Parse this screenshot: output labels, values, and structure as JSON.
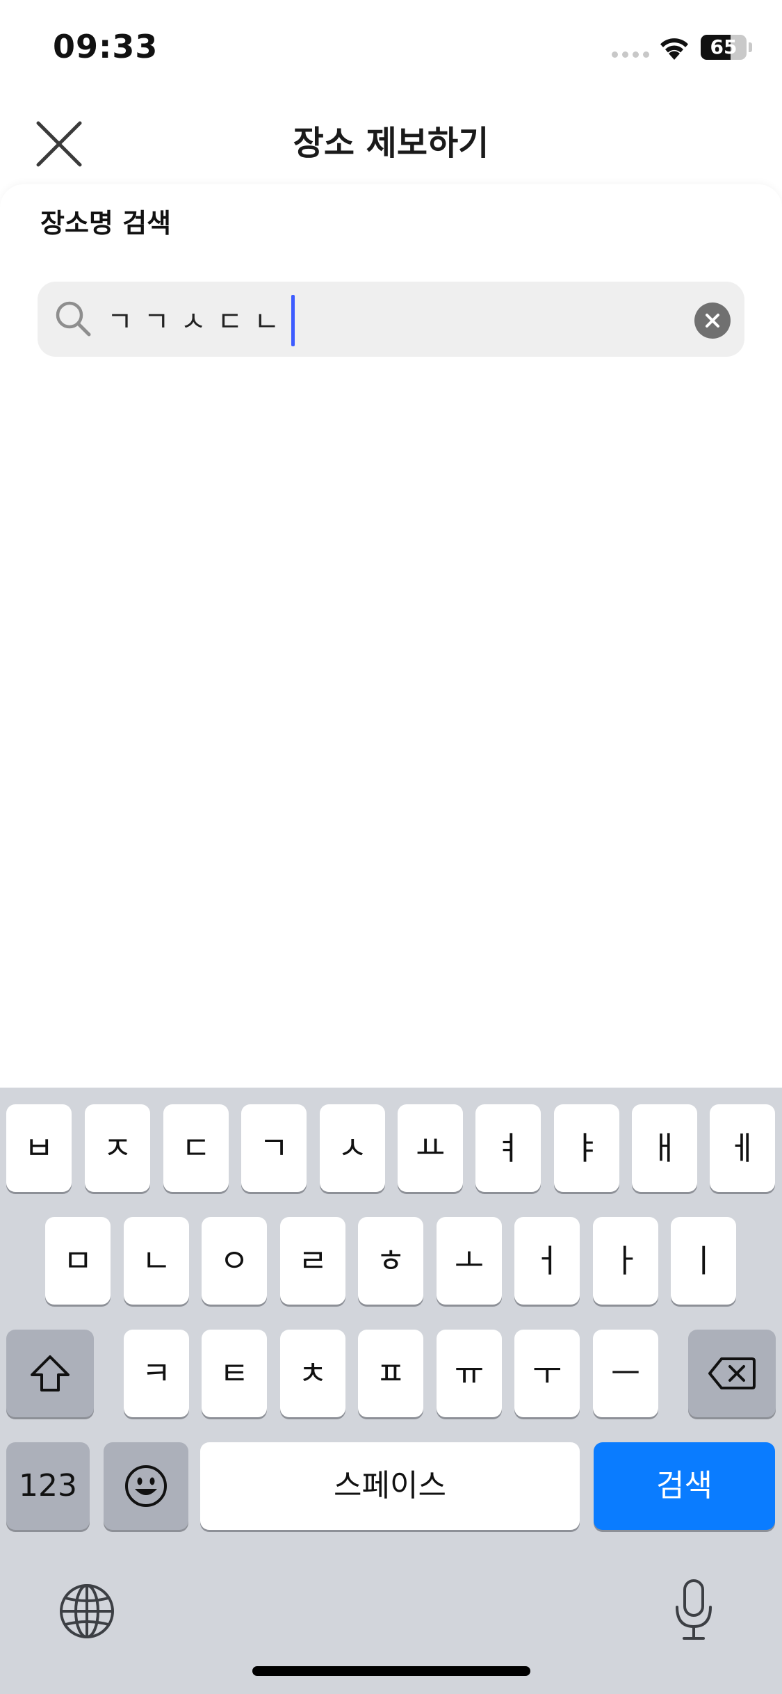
{
  "status_bar": {
    "time": "09:33",
    "battery": "65",
    "battery_level_percent": 65
  },
  "header": {
    "title": "장소 제보하기",
    "close_icon": "close-icon"
  },
  "search": {
    "section_label": "장소명 검색",
    "value": "ㄱㄱㅅㄷㄴ",
    "search_icon": "search-icon",
    "clear_icon": "clear-circle-icon"
  },
  "keyboard": {
    "row1": [
      "ㅂ",
      "ㅈ",
      "ㄷ",
      "ㄱ",
      "ㅅ",
      "ㅛ",
      "ㅕ",
      "ㅑ",
      "ㅐ",
      "ㅔ"
    ],
    "row2": [
      "ㅁ",
      "ㄴ",
      "ㅇ",
      "ㄹ",
      "ㅎ",
      "ㅗ",
      "ㅓ",
      "ㅏ",
      "ㅣ"
    ],
    "row3": [
      "ㅋ",
      "ㅌ",
      "ㅊ",
      "ㅍ",
      "ㅠ",
      "ㅜ",
      "ㅡ"
    ],
    "shift_icon": "shift-icon",
    "backspace_icon": "backspace-icon",
    "numbers_label": "123",
    "emoji_icon": "emoji-icon",
    "space_label": "스페이스",
    "return_label": "검색",
    "globe_icon": "globe-icon",
    "mic_icon": "microphone-icon"
  },
  "colors": {
    "accent_blue": "#0a7cff",
    "caret": "#3d5cff",
    "keyboard_bg": "#d2d5db"
  }
}
